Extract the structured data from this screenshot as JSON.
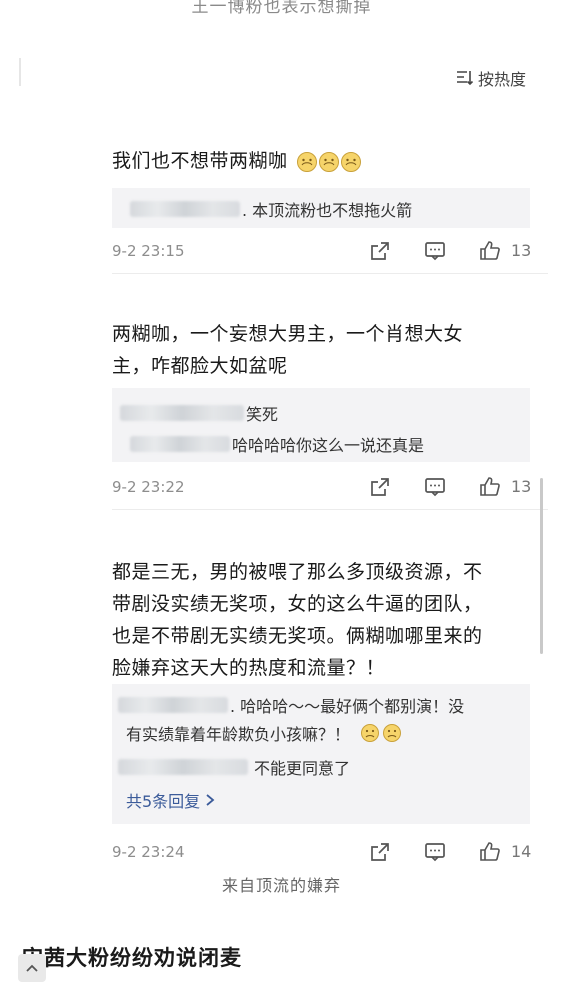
{
  "top_caption": "王一博粉也表示想撕掉",
  "sort": {
    "label": "按热度"
  },
  "comments": [
    {
      "text": "我们也不想带两糊咖",
      "emoji_count": 3,
      "replies": [
        {
          "text": ". 本顶流粉也不想拖火箭"
        }
      ],
      "time": "9-2 23:15",
      "likes": "13"
    },
    {
      "text_lines": [
        "两糊咖，一个妄想大男主，一个肖想大女",
        "主，咋都脸大如盆呢"
      ],
      "replies": [
        {
          "text": "笑死"
        },
        {
          "text": "哈哈哈哈你这么一说还真是"
        }
      ],
      "time": "9-2 23:22",
      "likes": "13"
    },
    {
      "text_lines": [
        "都是三无，男的被喂了那么多顶级资源，不",
        "带剧没实绩无奖项，女的这么牛逼的团队，",
        "也是不带剧无实绩无奖项。俩糊咖哪里来的",
        "脸嫌弃这天大的热度和流量？！"
      ],
      "replies": [
        {
          "text_lines": [
            ". 哈哈哈～～最好俩个都别演！没",
            "有实绩靠着年龄欺负小孩嘛？！"
          ]
        },
        {
          "text": "不能更同意了"
        }
      ],
      "more_replies": "共5条回复",
      "time": "9-2 23:24",
      "likes": "14"
    }
  ],
  "footer_caption": "来自顶流的嫌弃",
  "headline": "宋茜大粉纷纷劝说闭麦",
  "icons": {
    "share": "share-icon",
    "comment": "comment-icon",
    "like": "thumbs-up-icon",
    "sort": "sort-icon",
    "back_top": "chevron-up-icon"
  },
  "colors": {
    "link": "#3b5b9a",
    "reply_bg": "#f3f3f5",
    "meta": "#8d8d8d"
  }
}
